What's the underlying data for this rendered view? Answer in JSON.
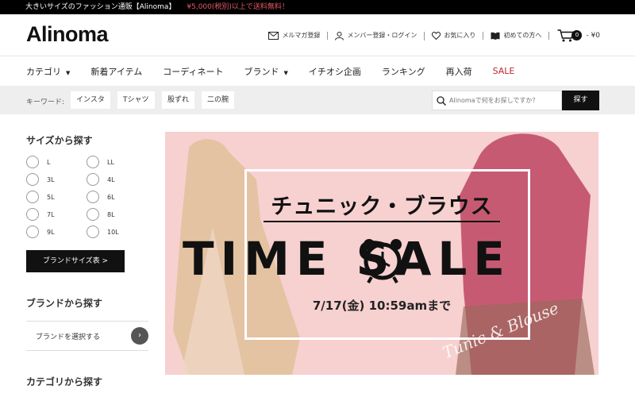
{
  "topbar": {
    "tagline": "大きいサイズのファッション通販【Alinoma】",
    "promo": "¥5,000(税別)以上で送料無料！"
  },
  "header": {
    "logo": "Alinoma",
    "nav": [
      {
        "label": "メルマガ登録",
        "icon": "mail-icon"
      },
      {
        "label": "メンバー登録・ログイン",
        "icon": "user-icon"
      },
      {
        "label": "お気に入り",
        "icon": "heart-icon"
      },
      {
        "label": "初めての方へ",
        "icon": "book-icon"
      }
    ],
    "cart": {
      "count": "0",
      "total": "- ¥0"
    }
  },
  "category_nav": {
    "items": [
      {
        "label": "カテゴリ",
        "arrow": "▼"
      },
      {
        "label": "新着アイテム"
      },
      {
        "label": "コーディネート"
      },
      {
        "label": "ブランド",
        "arrow": "▼"
      },
      {
        "label": "イチオシ企画"
      },
      {
        "label": "ランキング"
      },
      {
        "label": "再入荷"
      },
      {
        "label": "SALE"
      }
    ],
    "sale_color": "#c0272d"
  },
  "search": {
    "keyword_label": "キーワード:",
    "keywords": [
      "インスタ",
      "Tシャツ",
      "股ずれ",
      "二の腕"
    ],
    "placeholder": "Alinomaで何をお探しですか？",
    "button": "探す"
  },
  "sidebar": {
    "size_heading": "サイズから探す",
    "sizes": [
      "L",
      "LL",
      "3L",
      "4L",
      "5L",
      "6L",
      "7L",
      "8L",
      "9L",
      "10L"
    ],
    "size_table_button": "ブランドサイズ表 >",
    "brand_heading": "ブランドから探す",
    "brand_select": "ブランドを選択する",
    "brand_select_arrow": "›",
    "category_heading": "カテゴリから探す"
  },
  "banner": {
    "title": "チュニック・ブラウス",
    "headline": "TIME SALE",
    "deadline": "7/17(金) 10:59amまで",
    "script": "Tunic & Blouse",
    "bg_color": "#f7d0d0"
  }
}
